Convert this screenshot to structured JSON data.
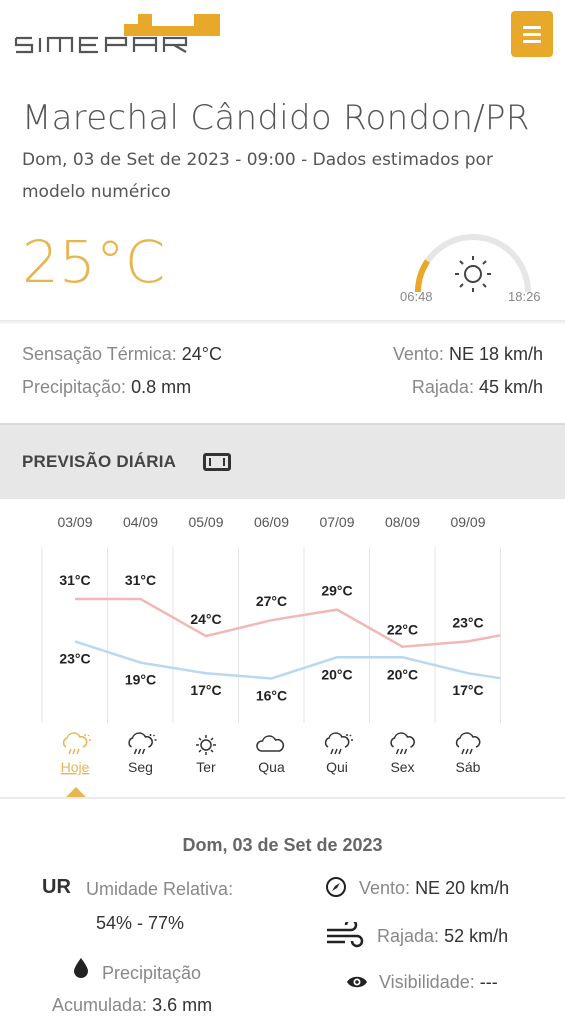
{
  "header": {
    "logo_text": "SIMEPAR",
    "menu_icon": "hamburger-icon",
    "accent": "#e8a92a"
  },
  "location": {
    "city": "Marechal Cândido Rondon/PR",
    "subtitle": "Dom, 03 de Set de 2023 - 09:00 - Dados estimados por modelo numérico"
  },
  "current": {
    "temperature": "25°C",
    "sunrise": "06:48",
    "sunset": "18:26",
    "sun_icon": "sun-icon",
    "sun_progress": 0.19
  },
  "conditions": {
    "feels_label": "Sensação Térmica:",
    "feels_value": "24°C",
    "precip_label": "Precipitação:",
    "precip_value": "0.8 mm",
    "wind_label": "Vento:",
    "wind_value": "NE 18 km/h",
    "gust_label": "Rajada:",
    "gust_value": "45 km/h"
  },
  "daily": {
    "title": "PREVISÃO DIÁRIA",
    "toggle_icon": "table-icon"
  },
  "chart_data": {
    "type": "line",
    "categories": [
      "03/09",
      "04/09",
      "05/09",
      "06/09",
      "07/09",
      "08/09",
      "09/09"
    ],
    "weekdays": [
      "Hoje",
      "Seg",
      "Ter",
      "Qua",
      "Qui",
      "Sex",
      "Sáb"
    ],
    "icons": [
      "rain-sun-icon",
      "rain-sun-icon",
      "sun-icon",
      "cloud-icon",
      "rain-sun-icon",
      "rain-icon",
      "rain-icon"
    ],
    "series": [
      {
        "values": [
          31,
          31,
          24,
          27,
          29,
          22,
          23
        ],
        "color": "#f2b8b8"
      },
      {
        "values": [
          23,
          19,
          17,
          16,
          20,
          20,
          17
        ],
        "color": "#b9d9f2"
      }
    ],
    "max_labels": [
      "31°C",
      "31°C",
      "24°C",
      "27°C",
      "29°C",
      "22°C",
      "23°C"
    ],
    "min_labels": [
      "23°C",
      "19°C",
      "17°C",
      "16°C",
      "20°C",
      "20°C",
      "17°C"
    ],
    "selected_index": 0
  },
  "details": {
    "date": "Dom, 03 de Set de 2023",
    "ur_abbr": "UR",
    "humidity_label": "Umidade Relativa:",
    "humidity_value": "54% - 77%",
    "precip_label_1": "Precipitação",
    "precip_label_2": "Acumulada:",
    "precip_value": "3.6 mm",
    "wind_label": "Vento:",
    "wind_value": "NE 20 km/h",
    "gust_label": "Rajada:",
    "gust_value": "52 km/h",
    "visibility_label": "Visibilidade:",
    "visibility_value": "---"
  }
}
